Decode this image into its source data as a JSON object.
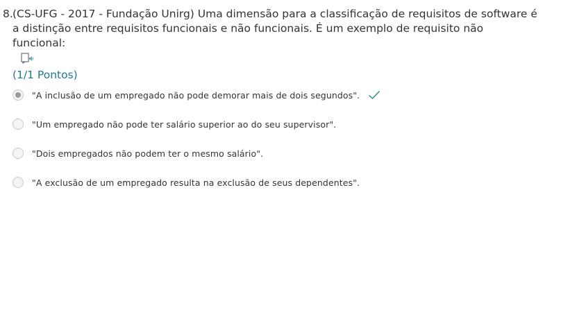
{
  "question": {
    "number": "8.",
    "text": "(CS-UFG - 2017 - Fundação Unirg) Uma dimensão para a classificação de requisitos de software é a distinção entre requisitos funcionais e não funcionais. É um exemplo de requisito não funcional:",
    "points": "(1/1 Pontos)",
    "reader_icon": "immersive-reader-icon"
  },
  "options": [
    {
      "text": "\"A inclusão de um empregado não pode demorar mais de dois segundos\".",
      "selected": true,
      "correct": true
    },
    {
      "text": "\"Um empregado não pode ter salário superior ao do seu supervisor\".",
      "selected": false,
      "correct": false
    },
    {
      "text": "\"Dois empregados não podem ter o mesmo salário\".",
      "selected": false,
      "correct": false
    },
    {
      "text": "\"A exclusão de um empregado resulta na exclusão de seus dependentes\".",
      "selected": false,
      "correct": false
    }
  ],
  "colors": {
    "accent": "#1f7a8c",
    "check": "#2e8b8b"
  }
}
